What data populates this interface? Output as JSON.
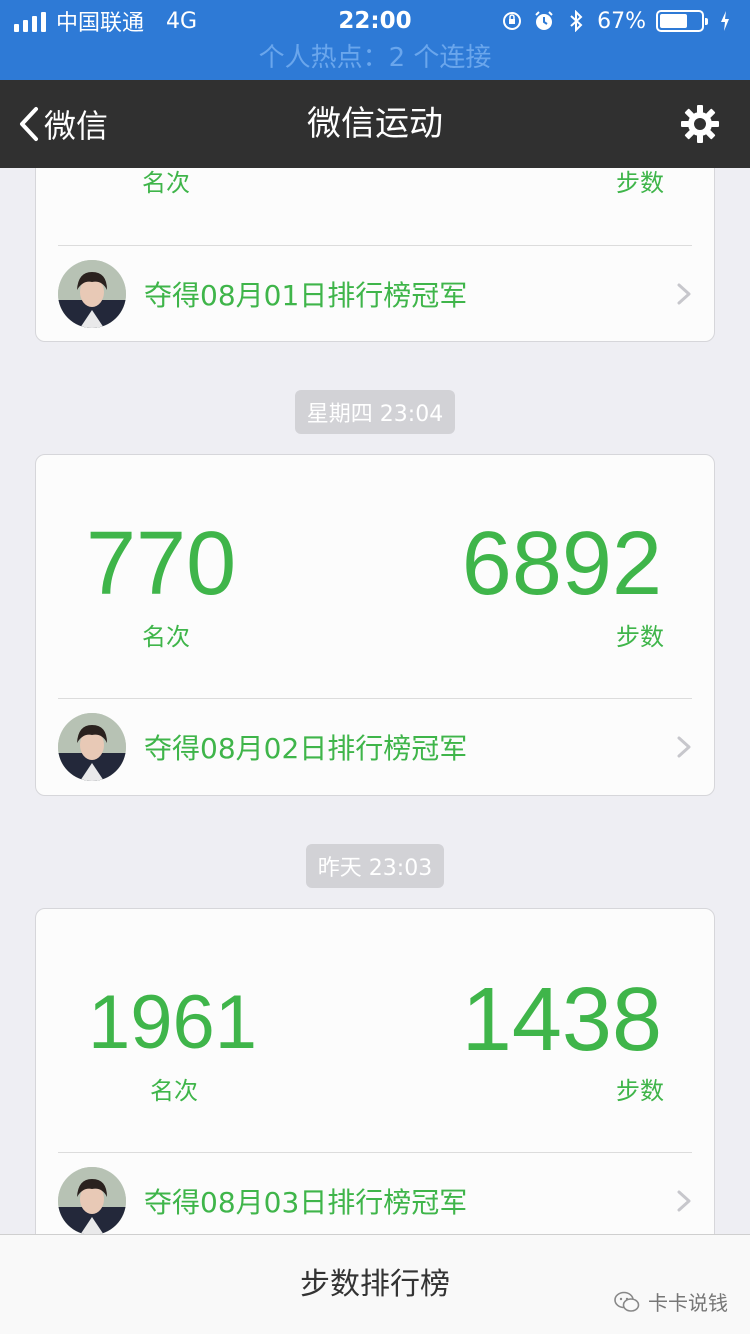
{
  "status_bar": {
    "carrier": "中国联通",
    "network": "4G",
    "time": "22:00",
    "battery_percent_label": "67%",
    "battery_level": 0.67,
    "hotspot": "个人热点：2 个连接"
  },
  "nav": {
    "back_label": "微信",
    "title": "微信运动"
  },
  "entries": [
    {
      "rank_label": "名次",
      "steps_label": "步数",
      "champion_text": "夺得08月01日排行榜冠军"
    },
    {
      "timestamp": "星期四 23:04",
      "rank": "770",
      "rank_label": "名次",
      "steps": "6892",
      "steps_label": "步数",
      "champion_text": "夺得08月02日排行榜冠军"
    },
    {
      "timestamp": "昨天 23:03",
      "rank": "1961",
      "rank_label": "名次",
      "steps": "1438",
      "steps_label": "步数",
      "champion_text": "夺得08月03日排行榜冠军"
    }
  ],
  "bottom": {
    "button_label": "步数排行榜",
    "watermark": "卡卡说钱"
  },
  "colors": {
    "accent_green": "#3fb54a",
    "status_blue": "#2e7ad6",
    "nav_dark": "#303030"
  },
  "icons": [
    "signal-icon",
    "orientation-lock-icon",
    "alarm-icon",
    "bluetooth-icon",
    "battery-icon",
    "charging-icon",
    "back-chevron-icon",
    "gear-icon",
    "avatar",
    "chevron-right-icon",
    "wechat-logo-icon"
  ]
}
